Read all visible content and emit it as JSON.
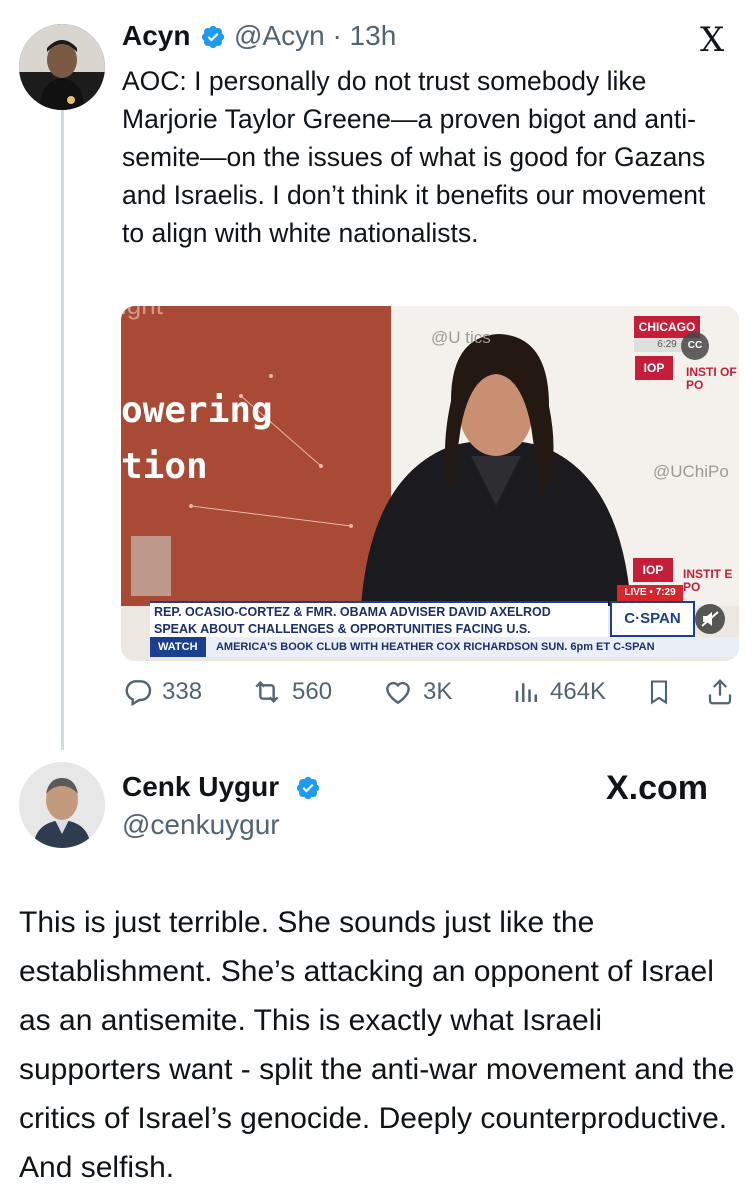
{
  "tweet1": {
    "name": "Acyn",
    "handle_time": "@Acyn · 13h",
    "text": "AOC: I personally do not trust somebody like Marjorie Taylor Greene—a proven bigot and anti-semite—on the issues of  what is good for Gazans and Israelis. I don’t think it benefits our movement to align with white nationalists.",
    "platform_logo": "X",
    "video": {
      "backdrop_line1": "owering",
      "backdrop_line2": "tion",
      "backdrop_top": "ight",
      "banner_source": "@U    tics",
      "chicago": "CHICAGO",
      "chicago_time": "6:29",
      "cc_label": "CC",
      "iop_label": "IOP",
      "institute_text": "INSTI OF PO",
      "uchipo": "@UChiPo",
      "live_label": "LIVE • 7:29",
      "institute_text2": "INSTIT E PO",
      "chyron_line1": "REP. OCASIO-CORTEZ & FMR. OBAMA ADVISER DAVID AXELROD",
      "chyron_line2": "SPEAK ABOUT CHALLENGES & OPPORTUNITIES FACING U.S.",
      "cspan_logo": "C·SPAN",
      "ticker_watch": "WATCH",
      "ticker_text": "AMERICA'S BOOK CLUB WITH HEATHER COX RICHARDSON  SUN. 6pm ET C-SPAN"
    },
    "actions": {
      "replies": "338",
      "reposts": "560",
      "likes": "3K",
      "views": "464K"
    }
  },
  "tweet2": {
    "name": "Cenk Uygur",
    "handle": "@cenkuygur",
    "site_label": "X.com",
    "text": "This is just terrible. She sounds just like the establishment. She’s attacking an opponent of Israel as an antisemite. This is exactly what Israeli supporters want - split the anti-war movement and the critics of Israel’s genocide. Deeply counterproductive. And selfish."
  },
  "colors": {
    "verified": "#1d9bf0",
    "muted": "#536471",
    "text": "#0f1419",
    "thread_line": "#cfd9de"
  }
}
